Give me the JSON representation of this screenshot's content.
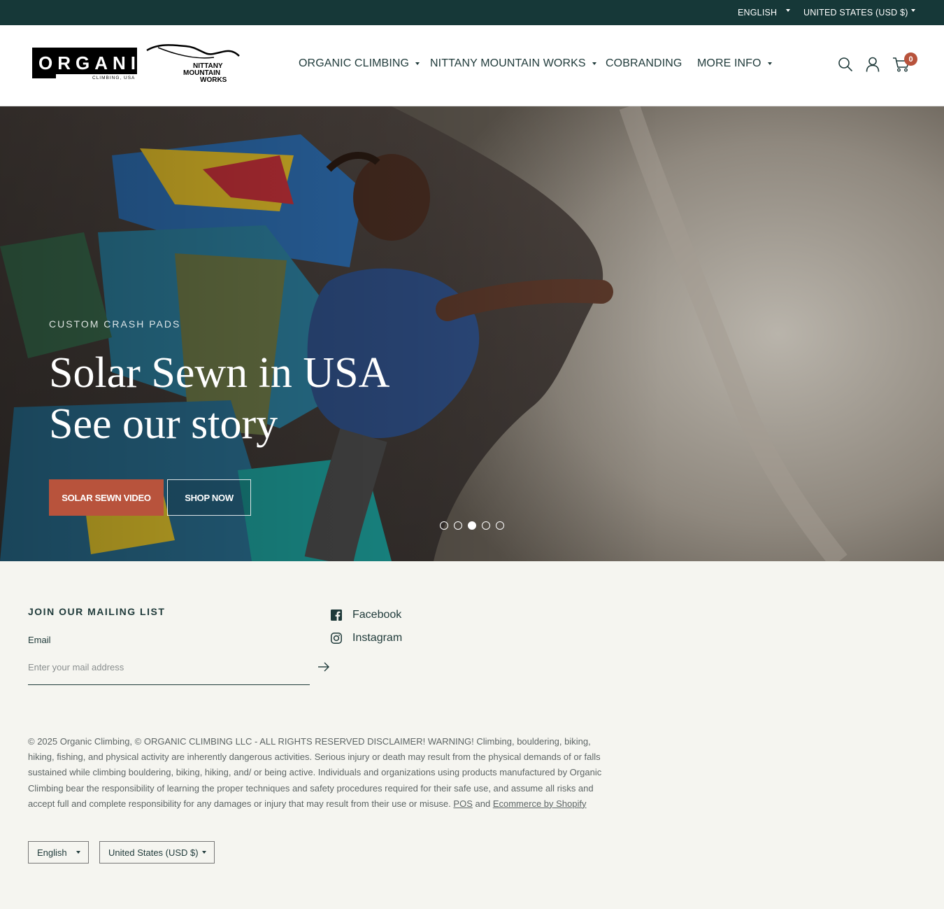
{
  "topbar": {
    "language": "ENGLISH",
    "currency": "UNITED STATES (USD $)"
  },
  "logos": {
    "organic_text": "ORGANIC",
    "organic_sub": "CLIMBING, USA",
    "nmw_line1": "NITTANY",
    "nmw_line2": "MOUNTAIN",
    "nmw_line3": "WORKS"
  },
  "nav": {
    "items": [
      {
        "label": "ORGANIC CLIMBING",
        "has_dropdown": true
      },
      {
        "label": "NITTANY MOUNTAIN WORKS",
        "has_dropdown": true
      },
      {
        "label": "COBRANDING",
        "has_dropdown": false
      },
      {
        "label": "MORE INFO",
        "has_dropdown": true
      }
    ],
    "cart_count": "0"
  },
  "hero": {
    "subtitle": "CUSTOM CRASH PADS",
    "title_line1": "Solar Sewn in USA",
    "title_line2": "See our story",
    "button_primary": "SOLAR SEWN VIDEO",
    "button_secondary": "SHOP NOW",
    "slides_total": 5,
    "active_slide": 3
  },
  "footer": {
    "mailing_heading": "JOIN OUR MAILING LIST",
    "email_label": "Email",
    "email_placeholder": "Enter your mail address",
    "social": [
      {
        "label": "Facebook",
        "icon": "facebook-icon"
      },
      {
        "label": "Instagram",
        "icon": "instagram-icon"
      }
    ],
    "copyright_text": "© 2025 Organic Climbing, © ORGANIC CLIMBING LLC - ALL RIGHTS RESERVED DISCLAIMER! WARNING! Climbing, bouldering, biking, hiking, fishing, and physical activity are inherently dangerous activities. Serious injury or death may result from the physical demands of or falls sustained while climbing bouldering, biking, hiking, and/ or being active. Individuals and organizations using products manufactured by Organic Climbing bear the responsibility of learning the proper techniques and safety procedures required for their safe use, and assume all risks and accept full and complete responsibility for any damages or injury that may result from their use or misuse.",
    "pos_link": "POS",
    "and_text": "and",
    "ecommerce_link": "Ecommerce by Shopify",
    "language_select": "English",
    "currency_select": "United States (USD $)"
  },
  "colors": {
    "topbar_bg": "#163838",
    "accent": "#b8533c",
    "text_dark": "#1f3a3a",
    "footer_bg": "#f5f5f0"
  }
}
